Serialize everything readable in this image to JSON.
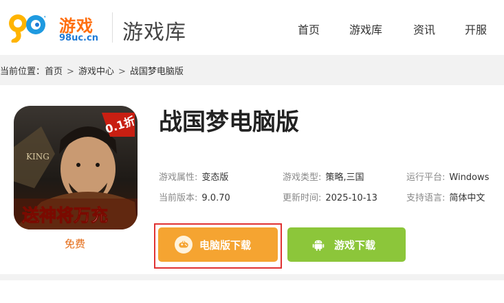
{
  "header": {
    "logo_text": "游戏",
    "logo_domain": "98uc.cn",
    "section_title": "游戏库",
    "nav": [
      "首页",
      "游戏库",
      "资讯",
      "开服"
    ]
  },
  "breadcrumb": {
    "prefix": "当前位置：",
    "items": [
      "首页",
      "游戏中心",
      "战国梦电脑版"
    ],
    "separator": ">"
  },
  "game": {
    "title": "战国梦电脑版",
    "price_label": "免费",
    "icon_badge": "0.1折",
    "icon_banner": "送神将万充",
    "info": [
      [
        {
          "label": "游戏属性:",
          "value": "变态版"
        },
        {
          "label": "游戏类型:",
          "value": "策略,三国"
        },
        {
          "label": "运行平台:",
          "value": "Windows"
        }
      ],
      [
        {
          "label": "当前版本:",
          "value": "9.0.70"
        },
        {
          "label": "更新时间:",
          "value": "2025-10-13"
        },
        {
          "label": "支持语言:",
          "value": "简体中文"
        }
      ]
    ]
  },
  "buttons": {
    "pc_download": "电脑版下载",
    "game_download": "游戏下载"
  },
  "colors": {
    "pc_button": "#f5a431",
    "game_button": "#8cc63a",
    "highlight_border": "#e03232",
    "logo_orange": "#ff6f0f",
    "logo_blue": "#1f7ad6"
  }
}
